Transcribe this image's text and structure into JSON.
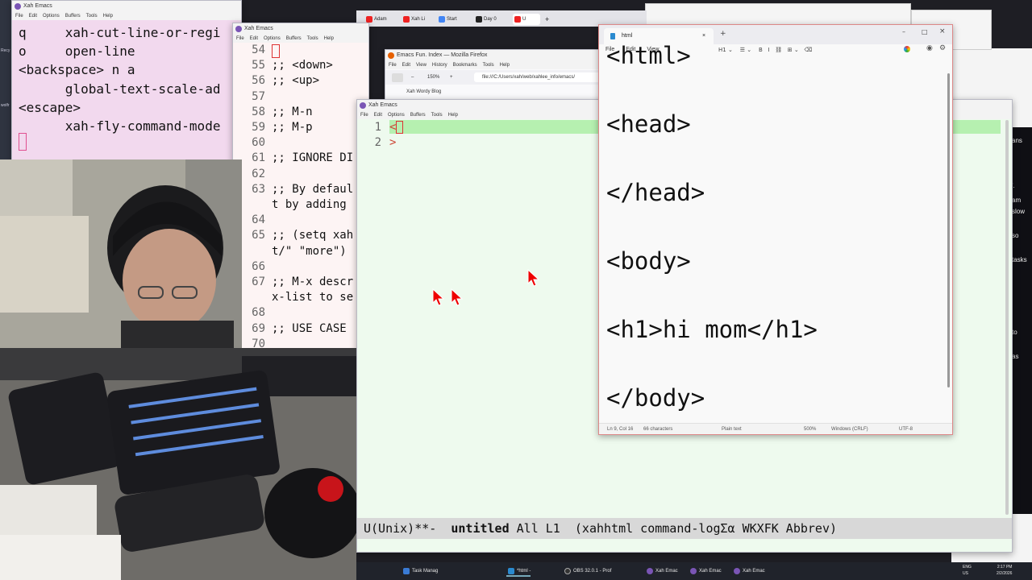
{
  "leftstrip": {
    "labels": [
      "Recy",
      "wolfr"
    ]
  },
  "emacs1": {
    "title": "Xah Emacs",
    "menu": [
      "File",
      "Edit",
      "Options",
      "Buffers",
      "Tools",
      "Help"
    ],
    "lines": [
      "q     xah-cut-line-or-regi",
      "o     open-line",
      "<backspace> n a",
      "      global-text-scale-ad",
      "<escape>",
      "      xah-fly-command-mode"
    ]
  },
  "emacs2": {
    "title": "Xah Emacs",
    "menu": [
      "File",
      "Edit",
      "Options",
      "Buffers",
      "Tools",
      "Help"
    ],
    "rows": [
      {
        "n": "54",
        "t": ""
      },
      {
        "n": "55",
        "t": ";; <down>"
      },
      {
        "n": "56",
        "t": ";; <up>"
      },
      {
        "n": "57",
        "t": ""
      },
      {
        "n": "58",
        "t": ";; M-n"
      },
      {
        "n": "59",
        "t": ";; M-p"
      },
      {
        "n": "60",
        "t": ""
      },
      {
        "n": "61",
        "t": ";; IGNORE DI"
      },
      {
        "n": "62",
        "t": ""
      },
      {
        "n": "63",
        "t": ";; By defaul"
      },
      {
        "n": "",
        "t": "t by adding"
      },
      {
        "n": "64",
        "t": ""
      },
      {
        "n": "65",
        "t": ";; (setq xah"
      },
      {
        "n": "",
        "t": "t/\" \"more\")"
      },
      {
        "n": "66",
        "t": ""
      },
      {
        "n": "67",
        "t": ";; M-x descr"
      },
      {
        "n": "",
        "t": "x-list to se"
      },
      {
        "n": "68",
        "t": ""
      },
      {
        "n": "69",
        "t": ";; USE CASE"
      },
      {
        "n": "70",
        "t": ""
      }
    ]
  },
  "tabstrip": {
    "tabs": [
      "Adam",
      "Xah Li",
      "Start",
      "Day 0",
      "U"
    ]
  },
  "firefox": {
    "title": "Emacs Fun. Index — Mozilla Firefox",
    "menu": [
      "File",
      "Edit",
      "View",
      "History",
      "Bookmarks",
      "Tools",
      "Help"
    ],
    "zoom": "150%",
    "url": "file:///C:/Users/xah/web/xahlee_info/emacs/",
    "bookmark": "Xah Wordy Blog"
  },
  "emacs3": {
    "title": "Xah Emacs",
    "menu": [
      "File",
      "Edit",
      "Options",
      "Buffers",
      "Tools",
      "Help"
    ],
    "gutter": [
      "1",
      "2"
    ],
    "lines": [
      "<",
      ">"
    ],
    "modeline_prefix": "U(Unix)**-  ",
    "modeline_buffer": "untitled",
    "modeline_rest": " All L1  (xahhtml command-logΣα WKXFK Abbrev)"
  },
  "notepad": {
    "tab_label": "html",
    "menu": [
      "File",
      "Edit",
      "View"
    ],
    "format_bar": "H1 ⌄    ☰ ⌄    B   I   ⛓   ⊞ ⌄   ⌫",
    "lines": [
      "<html>",
      "<head>",
      "</head>",
      "<body>",
      "<h1>hi mom</h1>",
      "</body>"
    ],
    "status": {
      "position": "Ln 9, Col 16",
      "chars": "66 characters",
      "mode": "Plain text",
      "zoom": "500%",
      "eol": "Windows (CRLF)",
      "encoding": "UTF-8"
    }
  },
  "rightdark": {
    "fragments": [
      "ans",
      "'.",
      "am",
      "slow",
      "so",
      "tasks",
      "to",
      "as"
    ]
  },
  "taskbar": {
    "items": [
      "Task Manag",
      "*html -",
      "OBS 32.0.1 - Prof",
      "Xah Emac",
      "Xah Emac",
      "Xah Emac"
    ],
    "lang": "ENG",
    "region": "US",
    "time": "2:17 PM",
    "date": "2/2/2026"
  },
  "colors": {
    "emacs_pink": "#f2d9ee",
    "emacs_green": "#eefaee",
    "line_highlight": "#b6f0b0",
    "modeline": "#d8d8d8",
    "taskbar": "#20232b"
  }
}
